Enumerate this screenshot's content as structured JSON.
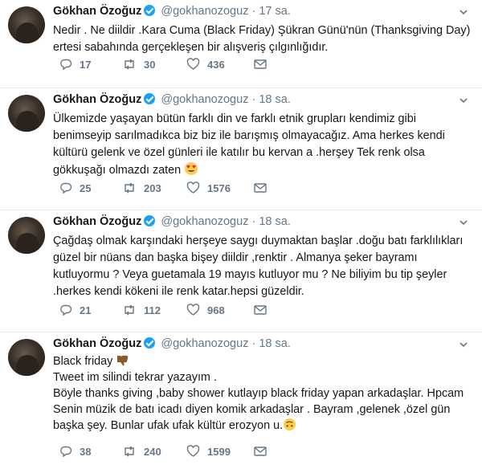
{
  "tweets": [
    {
      "name": "Gökhan Özoğuz",
      "handle": "@gokhanozoguz",
      "dot": "·",
      "time": "17 sa.",
      "lines": [
        "Nedir . Ne diildir .Kara Cuma (Black Friday) Şükran Günü'nün (Thanksgiving Day)",
        "ertesi sabahında gerçekleşen bir alışveriş çılgınlığıdır."
      ],
      "replies": "17",
      "retweets": "30",
      "likes": "436"
    },
    {
      "name": "Gökhan Özoğuz",
      "handle": "@gokhanozoguz",
      "dot": "·",
      "time": "18 sa.",
      "lines": [
        "Ülkemizde yaşayan bütün farklı din ve farklı etnik grupları kendimiz gibi",
        "benimseyip sarılmadıkca biz biz ile barışmış olmayacağız. Ama herkes kendi",
        "kültürü gelenk ve özel günleri  ile katılır bu kervan a .herşey Tek renk olsa",
        "gökkuşağı olmazdı zaten"
      ],
      "replies": "25",
      "retweets": "203",
      "likes": "1576"
    },
    {
      "name": "Gökhan Özoğuz",
      "handle": "@gokhanozoguz",
      "dot": "·",
      "time": "18 sa.",
      "lines": [
        "Çağdaş olmak karşındaki herşeye saygı duymaktan başlar .doğu batı farklılıkları",
        "güzel bir nüans dan başka bişey diildir ,renktir . Almanya şeker bayramı",
        "kutluyormu ? Veya guetamala 19 mayıs kutluyor mu ? Ne biliyim bu tip şeyler",
        ".herkes kendi kökeni ile renk katar.hepsi güzeldir."
      ],
      "replies": "21",
      "retweets": "112",
      "likes": "968"
    },
    {
      "name": "Gökhan Özoğuz",
      "handle": "@gokhanozoguz",
      "dot": "·",
      "time": "18 sa.",
      "lines": [
        "Black friday",
        "Tweet im silindi tekrar yazayım .",
        "Böyle thanks giving ,baby shower kutlayıp black friday yapan arkadaşlar. Hpcam",
        "Senin müzik de  batı icadı diyen komik arkadaşlar . Bayram ,gelenek ,özel gün",
        "başka şey. Bunlar ufak ufak kültür erozyon u."
      ],
      "replies": "38",
      "retweets": "240",
      "likes": "1599"
    }
  ],
  "icons": {
    "verified": "verified-badge-icon",
    "reply": "reply-icon",
    "retweet": "retweet-icon",
    "like": "heart-icon",
    "dm": "envelope-icon",
    "menu": "chevron-down-icon"
  },
  "colors": {
    "text": "#14171a",
    "secondary": "#657786",
    "verified": "#1da1f2",
    "divider": "#e6ecf0"
  }
}
